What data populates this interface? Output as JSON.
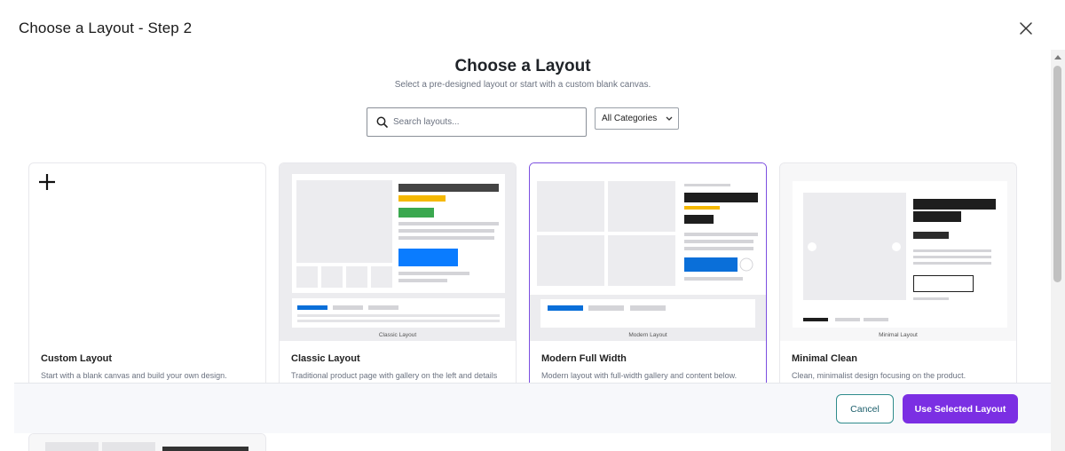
{
  "header": {
    "title": "Choose a Layout - Step 2"
  },
  "intro": {
    "heading": "Choose a Layout",
    "subheading": "Select a pre-designed layout or start with a custom blank canvas."
  },
  "search": {
    "placeholder": "Search layouts...",
    "value": ""
  },
  "filter": {
    "selected": "All Categories"
  },
  "cards": [
    {
      "title": "Custom Layout",
      "description": "Start with a blank canvas and build your own design.",
      "thumb_label": ""
    },
    {
      "title": "Classic Layout",
      "description": "Traditional product page with gallery on the left and details",
      "thumb_label": "Classic Layout"
    },
    {
      "title": "Modern Full Width",
      "description": "Modern layout with full-width gallery and content below.",
      "thumb_label": "Modern Layout"
    },
    {
      "title": "Minimal Clean",
      "description": "Clean, minimalist design focusing on the product.",
      "thumb_label": "Minimal Layout"
    }
  ],
  "selected_card": "Modern Full Width",
  "footer": {
    "cancel_label": "Cancel",
    "use_label": "Use Selected Layout"
  },
  "colors": {
    "accent": "#7b2fe3",
    "selected_border": "#7c4fe0",
    "cancel_border": "#2f8c8c",
    "mock_blue": "#0a7cff",
    "mock_yellow": "#f5b800",
    "mock_green": "#3aa84f"
  },
  "icons": {
    "close": "close-icon",
    "search": "search-icon",
    "dropdown": "chevron-down-icon",
    "custom": "plus-icon"
  }
}
